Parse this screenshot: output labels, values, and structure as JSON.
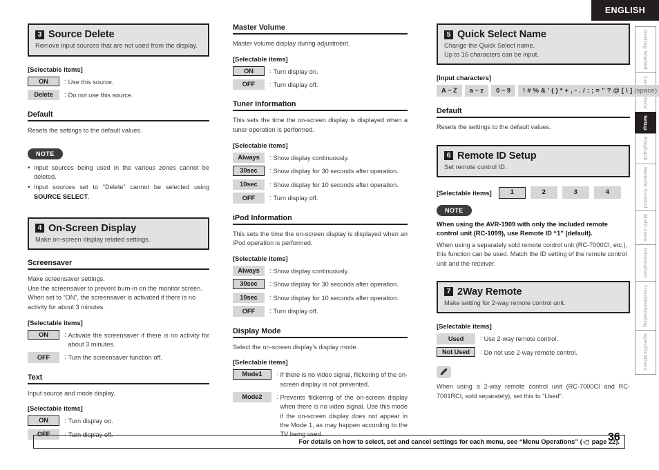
{
  "header": {
    "language": "ENGLISH"
  },
  "tabs": [
    {
      "label": "Getting Started",
      "active": false
    },
    {
      "label": "Connections",
      "active": false
    },
    {
      "label": "Setup",
      "active": true
    },
    {
      "label": "Playback",
      "active": false
    },
    {
      "label": "Remote Control",
      "active": false
    },
    {
      "label": "Multi-zone",
      "active": false
    },
    {
      "label": "Information",
      "active": false
    },
    {
      "label": "Troubleshooting",
      "active": false
    },
    {
      "label": "Specifications",
      "active": false
    }
  ],
  "labels": {
    "selectable_items": "[Selectable items]",
    "input_characters": "[Input characters]",
    "note": "NOTE",
    "colon": ":"
  },
  "section_source_delete": {
    "number": "3",
    "title": "Source Delete",
    "desc": "Remove input sources that are not used from the display.",
    "options": [
      {
        "chip": "ON",
        "selected": true,
        "text": "Use this source."
      },
      {
        "chip": "Delete",
        "selected": false,
        "text": "Do not use this source."
      }
    ],
    "default_heading": "Default",
    "default_text": "Resets the settings to the default values.",
    "notes": [
      "Input sources being used in the various zones cannot be deleted.",
      "Input sources set to “Delete” cannot be selected using SOURCE SELECT."
    ],
    "note2_plain_a": "Input sources set to “Delete” cannot be selected using ",
    "note2_bold": "SOURCE SELECT",
    "note2_plain_b": "."
  },
  "section_osd": {
    "number": "4",
    "title": "On-Screen Display",
    "desc": "Make on-screen display related settings.",
    "screensaver": {
      "heading": "Screensaver",
      "paras": [
        "Make screensaver settings.",
        "Use the screensaver to prevent burn-in on the monitor screen.",
        "When set to “ON”, the screensaver is activated if there is no activity for about 3 minutes."
      ],
      "options": [
        {
          "chip": "ON",
          "selected": true,
          "text": "Activate the screensaver if there is no activity for about 3 minutes."
        },
        {
          "chip": "OFF",
          "selected": false,
          "text": "Turn the screensaver function off."
        }
      ]
    },
    "text": {
      "heading": "Text",
      "para": "Input source and mode display.",
      "options": [
        {
          "chip": "ON",
          "selected": true,
          "text": "Turn display on."
        },
        {
          "chip": "OFF",
          "selected": false,
          "text": "Turn display off."
        }
      ]
    },
    "master_volume": {
      "heading": "Master Volume",
      "para": "Master volume display during adjustment.",
      "options": [
        {
          "chip": "ON",
          "selected": true,
          "text": "Turn display on."
        },
        {
          "chip": "OFF",
          "selected": false,
          "text": "Turn display off."
        }
      ]
    },
    "tuner_information": {
      "heading": "Tuner Information",
      "para": "This sets the time the on-screen display is displayed when a tuner operation is performed.",
      "options": [
        {
          "chip": "Always",
          "selected": false,
          "text": "Show display continuously."
        },
        {
          "chip": "30sec",
          "selected": true,
          "text": "Show display for 30 seconds after operation."
        },
        {
          "chip": "10sec",
          "selected": false,
          "text": "Show display for 10 seconds after operation."
        },
        {
          "chip": "OFF",
          "selected": false,
          "text": "Turn display off."
        }
      ]
    },
    "ipod_information": {
      "heading": "iPod Information",
      "para": "This sets the time the on-screen display is displayed when an iPod operation is performed.",
      "options": [
        {
          "chip": "Always",
          "selected": false,
          "text": "Show display continuously."
        },
        {
          "chip": "30sec",
          "selected": true,
          "text": "Show display for 30 seconds after operation."
        },
        {
          "chip": "10sec",
          "selected": false,
          "text": "Show display for 10 seconds after operation."
        },
        {
          "chip": "OFF",
          "selected": false,
          "text": "Turn display off."
        }
      ]
    },
    "display_mode": {
      "heading": "Display Mode",
      "para": "Select the on-screen display’s display mode.",
      "options": [
        {
          "chip": "Mode1",
          "selected": true,
          "text": "If there is no video signal, flickering of the on-screen display is not prevented."
        },
        {
          "chip": "Mode2",
          "selected": false,
          "text": "Prevents flickering of the on-screen display when there is no video signal. Use this mode if the on-screen display does not appear in the Mode 1, as may happen according to the TV being used."
        }
      ]
    }
  },
  "section_quick_select": {
    "number": "5",
    "title": "Quick Select Name",
    "desc_line1": "Change the Quick Select name.",
    "desc_line2": "Up to 16 characters can be input.",
    "input_chips": [
      "A ~ Z",
      "a ~ z",
      "0 ~ 9"
    ],
    "symbols": "! # % & ’ ( ) * + , - . / : ; = ” ? @ [ \\ ]",
    "space_note": "(space)",
    "default_heading": "Default",
    "default_text": "Resets the settings to the default values."
  },
  "section_remote_id": {
    "number": "6",
    "title": "Remote ID Setup",
    "desc": "Set remote control ID.",
    "ids": [
      {
        "label": "1",
        "selected": true
      },
      {
        "label": "2",
        "selected": false
      },
      {
        "label": "3",
        "selected": false
      },
      {
        "label": "4",
        "selected": false
      }
    ],
    "note_bold": "When using the AVR-1909 with only the included remote control unit (RC-1099), use Remote ID “1” (default).",
    "note_plain": "When using a separately sold remote control unit (RC-7000CI, etc.), this function can be used. Match the ID setting of the remote control unit and the receiver."
  },
  "section_2way": {
    "number": "7",
    "title": "2Way Remote",
    "desc": "Make setting for 2-way remote control unit.",
    "options": [
      {
        "chip": "Used",
        "selected": false,
        "text": "Use 2-way remote control."
      },
      {
        "chip": "Not Used",
        "selected": true,
        "text": "Do not use 2-way remote control."
      }
    ],
    "tip_text": "When using a 2-way remote control unit (RC-7000CI and RC-7001RCI, sold separately), set this to “Used”."
  },
  "footer": {
    "text_before": "For details on how to select, set and cancel settings for each menu, see “Menu Operations” (",
    "page_ref": "page 22",
    "text_after": ").",
    "page_number": "36"
  }
}
